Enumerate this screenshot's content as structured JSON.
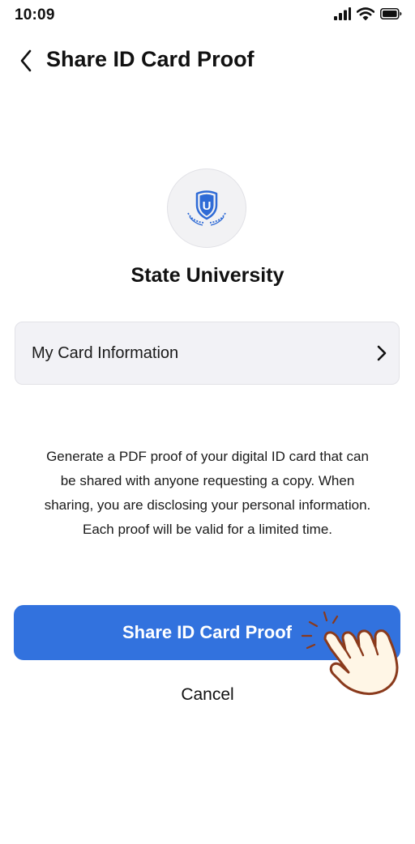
{
  "status_bar": {
    "time": "10:09",
    "icons": [
      "signal-icon",
      "wifi-icon",
      "battery-icon"
    ]
  },
  "header": {
    "back_icon": "chevron-left-icon",
    "title": "Share ID Card Proof"
  },
  "institution": {
    "logo_icon": "university-shield-logo",
    "logo_letter": "U",
    "name": "State University"
  },
  "card_info_row": {
    "label": "My Card Information",
    "chevron_icon": "chevron-right-icon"
  },
  "description": {
    "lines": [
      "Generate a PDF proof of your digital ID card that can",
      "be shared with anyone requesting a copy. When",
      "sharing,  you are disclosing your personal information.",
      "Each proof will be valid for a limited time."
    ]
  },
  "actions": {
    "share_label": "Share ID Card Proof",
    "cancel_label": "Cancel"
  },
  "colors": {
    "primary": "#3272de",
    "logo_blue": "#2f6bd6",
    "hand_outline": "#8a3a1c",
    "hand_fill": "#fff6e6"
  }
}
